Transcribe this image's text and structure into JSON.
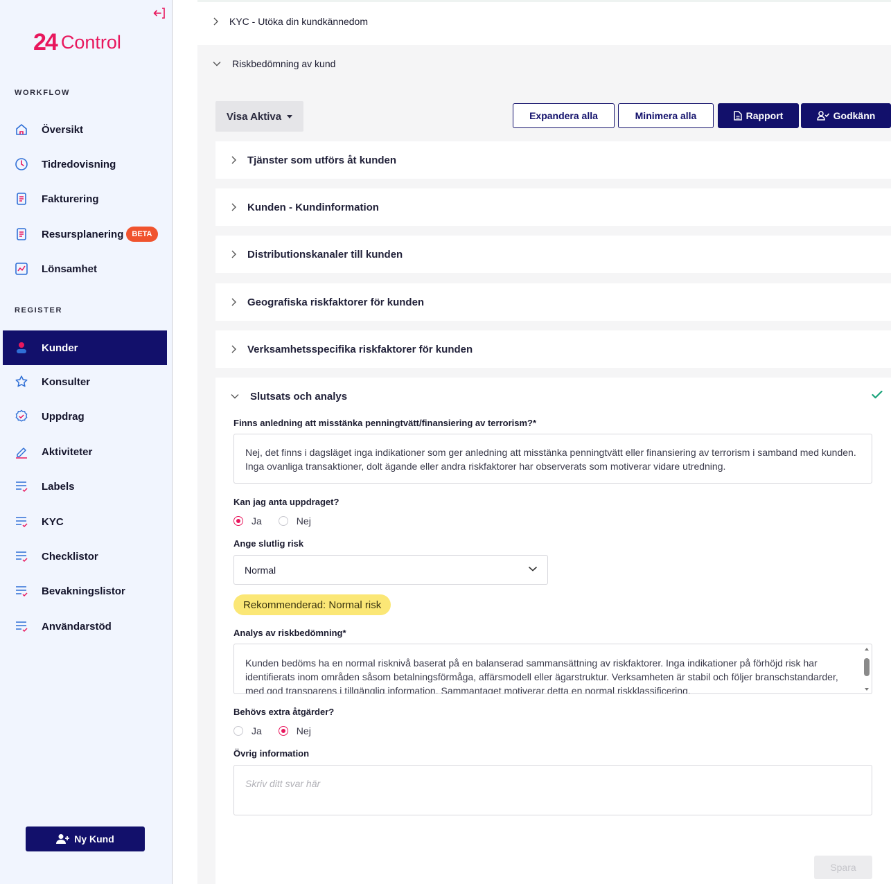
{
  "app": {
    "logo_mark": "24",
    "logo_text": "Control"
  },
  "sidebar": {
    "section_workflow": "WORKFLOW",
    "section_register": "REGISTER",
    "workflow_items": [
      {
        "label": "Översikt",
        "icon": "home-icon"
      },
      {
        "label": "Tidredovisning",
        "icon": "clock-icon"
      },
      {
        "label": "Fakturering",
        "icon": "document-icon"
      },
      {
        "label": "Resursplanering",
        "icon": "document-icon",
        "badge": "BETA"
      },
      {
        "label": "Lönsamhet",
        "icon": "chart-icon"
      }
    ],
    "register_items": [
      {
        "label": "Kunder",
        "icon": "person-icon",
        "active": true
      },
      {
        "label": "Konsulter",
        "icon": "star-icon"
      },
      {
        "label": "Uppdrag",
        "icon": "badge-check-icon"
      },
      {
        "label": "Aktiviteter",
        "icon": "pencil-icon"
      },
      {
        "label": "Labels",
        "icon": "list-check-icon"
      },
      {
        "label": "KYC",
        "icon": "list-check-icon"
      },
      {
        "label": "Checklistor",
        "icon": "list-check-icon"
      },
      {
        "label": "Bevakningslistor",
        "icon": "list-check-icon"
      },
      {
        "label": "Användarstöd",
        "icon": "list-check-icon"
      }
    ],
    "new_customer_button": "Ny Kund"
  },
  "main": {
    "kyc_row": "KYC - Utöka din kundkännedom",
    "risk_title": "Riskbedömning av kund",
    "toolbar": {
      "visa_label": "Visa Aktiva",
      "expand_label": "Expandera alla",
      "minimize_label": "Minimera alla",
      "report_label": "Rapport",
      "approve_label": "Godkänn"
    },
    "sections": [
      "Tjänster som utförs åt kunden",
      "Kunden - Kundinformation",
      "Distributionskanaler till kunden",
      "Geografiska riskfaktorer för kunden",
      "Verksamhetsspecifika riskfaktorer för kunden"
    ],
    "conclusion": {
      "title": "Slutsats och analys",
      "q1_label": "Finns anledning att misstänka penningtvätt/finansiering av terrorism?*",
      "q1_value": "Nej, det finns i dagsläget inga indikationer som ger anledning att misstänka penningtvätt eller finansiering av terrorism i samband med kunden. Inga ovanliga transaktioner, dolt ägande eller andra riskfaktorer har observerats som motiverar vidare utredning.",
      "q2_label": "Kan jag anta uppdraget?",
      "q2_options": [
        "Ja",
        "Nej"
      ],
      "q2_selected": "Ja",
      "q3_label": "Ange slutlig risk",
      "q3_value": "Normal",
      "recommendation": "Rekommenderad: Normal risk",
      "q4_label": "Analys av riskbedömning*",
      "q4_value": "Kunden bedöms ha en normal risknivå baserat på en balanserad sammansättning av riskfaktorer. Inga indikationer på förhöjd risk har identifierats inom områden såsom betalningsförmåga, affärsmodell eller ägarstruktur. Verksamheten är stabil och följer branschstandarder, med god transparens i tillgänglig information. Sammantaget motiverar detta en normal riskklassificering.",
      "q5_label": "Behövs extra åtgärder?",
      "q5_options": [
        "Ja",
        "Nej"
      ],
      "q5_selected": "Nej",
      "q6_label": "Övrig information",
      "q6_placeholder": "Skriv ditt svar här",
      "save_label": "Spara"
    }
  },
  "colors": {
    "brand": "#e8175d",
    "navy": "#12106b",
    "beta": "#f0532e",
    "success": "#1aa37a",
    "recommend": "#fbe776"
  }
}
